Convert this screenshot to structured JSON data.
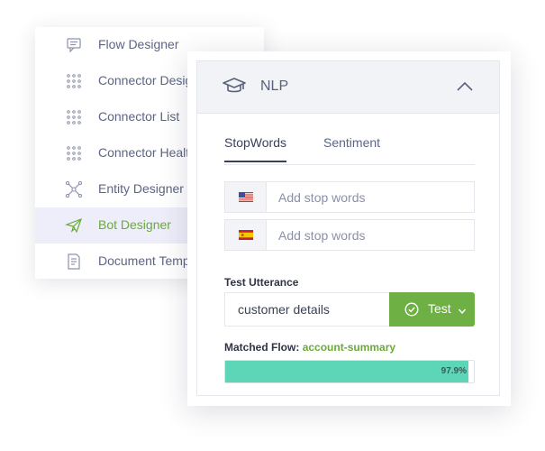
{
  "menu": {
    "items": [
      {
        "label": "Flow Designer",
        "icon": "chat-icon",
        "active": false
      },
      {
        "label": "Connector Designer",
        "icon": "dots-grid-icon",
        "active": false
      },
      {
        "label": "Connector List",
        "icon": "dots-grid-icon",
        "active": false
      },
      {
        "label": "Connector Health",
        "icon": "dots-grid-icon",
        "active": false
      },
      {
        "label": "Entity Designer",
        "icon": "network-icon",
        "active": false
      },
      {
        "label": "Bot Designer",
        "icon": "paper-plane-icon",
        "active": true
      },
      {
        "label": "Document Templates",
        "icon": "document-icon",
        "active": false
      }
    ]
  },
  "nlp": {
    "title": "NLP",
    "tabs": [
      {
        "label": "StopWords",
        "active": true
      },
      {
        "label": "Sentiment",
        "active": false
      }
    ],
    "stopwords": [
      {
        "flag": "us-flag-icon",
        "placeholder": "Add stop words",
        "value": ""
      },
      {
        "flag": "es-flag-icon",
        "placeholder": "Add stop words",
        "value": ""
      }
    ],
    "test_utterance_label": "Test Utterance",
    "test_utterance_value": "customer details",
    "test_button_label": "Test",
    "matched_flow_label": "Matched Flow:",
    "matched_flow_value": "account-summary",
    "progress_percent": 97.9,
    "progress_label": "97.9%"
  },
  "colors": {
    "accent_green": "#6eb043",
    "progress_teal": "#5dd6b8",
    "active_row_bg": "#edeef9",
    "text_muted": "#5b6585"
  }
}
